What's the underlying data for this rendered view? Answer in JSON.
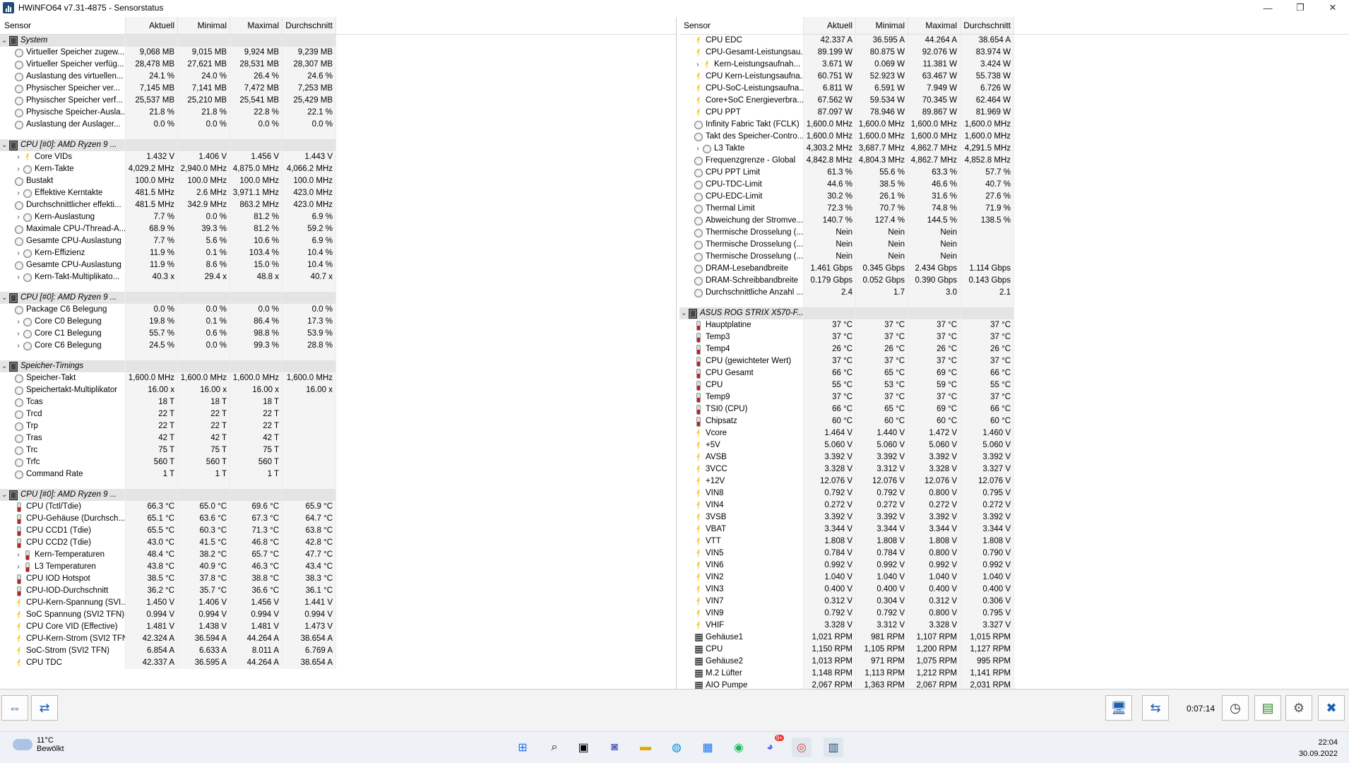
{
  "window": {
    "title": "HWiNFO64 v7.31-4875 - Sensorstatus",
    "buttons": [
      "—",
      "❐",
      "✕"
    ]
  },
  "columns": [
    "Sensor",
    "Aktuell",
    "Minimal",
    "Maximal",
    "Durchschnitt"
  ],
  "left_rows": [
    {
      "t": "g",
      "name": "System"
    },
    {
      "t": "r",
      "icon": "circle",
      "name": "Virtueller Speicher zugew...",
      "v": [
        "9,068 MB",
        "9,015 MB",
        "9,924 MB",
        "9,239 MB"
      ]
    },
    {
      "t": "r",
      "icon": "circle",
      "name": "Virtueller Speicher verfüg...",
      "v": [
        "28,478 MB",
        "27,621 MB",
        "28,531 MB",
        "28,307 MB"
      ]
    },
    {
      "t": "r",
      "icon": "circle",
      "name": "Auslastung des virtuellen...",
      "v": [
        "24.1 %",
        "24.0 %",
        "26.4 %",
        "24.6 %"
      ]
    },
    {
      "t": "r",
      "icon": "circle",
      "name": "Physischer Speicher ver...",
      "v": [
        "7,145 MB",
        "7,141 MB",
        "7,472 MB",
        "7,253 MB"
      ]
    },
    {
      "t": "r",
      "icon": "circle",
      "name": "Physischer Speicher verf...",
      "v": [
        "25,537 MB",
        "25,210 MB",
        "25,541 MB",
        "25,429 MB"
      ]
    },
    {
      "t": "r",
      "icon": "circle",
      "name": "Physische Speicher-Ausla...",
      "v": [
        "21.8 %",
        "21.8 %",
        "22.8 %",
        "22.1 %"
      ]
    },
    {
      "t": "r",
      "icon": "circle",
      "name": "Auslastung der Auslager...",
      "v": [
        "0.0 %",
        "0.0 %",
        "0.0 %",
        "0.0 %"
      ]
    },
    {
      "t": "s"
    },
    {
      "t": "g",
      "name": "CPU [#0]: AMD Ryzen 9 ..."
    },
    {
      "t": "r",
      "exp": true,
      "icon": "volt",
      "name": "Core VIDs",
      "v": [
        "1.432 V",
        "1.406 V",
        "1.456 V",
        "1.443 V"
      ]
    },
    {
      "t": "r",
      "exp": true,
      "icon": "circle",
      "name": "Kern-Takte",
      "v": [
        "4,029.2 MHz",
        "2,940.0 MHz",
        "4,875.0 MHz",
        "4,066.2 MHz"
      ]
    },
    {
      "t": "r",
      "icon": "circle",
      "name": "Bustakt",
      "v": [
        "100.0 MHz",
        "100.0 MHz",
        "100.0 MHz",
        "100.0 MHz"
      ]
    },
    {
      "t": "r",
      "exp": true,
      "icon": "circle",
      "name": "Effektive Kerntakte",
      "v": [
        "481.5 MHz",
        "2.6 MHz",
        "3,971.1 MHz",
        "423.0 MHz"
      ]
    },
    {
      "t": "r",
      "icon": "circle",
      "name": "Durchschnittlicher effekti...",
      "v": [
        "481.5 MHz",
        "342.9 MHz",
        "863.2 MHz",
        "423.0 MHz"
      ]
    },
    {
      "t": "r",
      "exp": true,
      "icon": "circle",
      "name": "Kern-Auslastung",
      "v": [
        "7.7 %",
        "0.0 %",
        "81.2 %",
        "6.9 %"
      ]
    },
    {
      "t": "r",
      "icon": "circle",
      "name": "Maximale CPU-/Thread-A...",
      "v": [
        "68.9 %",
        "39.3 %",
        "81.2 %",
        "59.2 %"
      ]
    },
    {
      "t": "r",
      "icon": "circle",
      "name": "Gesamte CPU-Auslastung",
      "v": [
        "7.7 %",
        "5.6 %",
        "10.6 %",
        "6.9 %"
      ]
    },
    {
      "t": "r",
      "exp": true,
      "icon": "circle",
      "name": "Kern-Effizienz",
      "v": [
        "11.9 %",
        "0.1 %",
        "103.4 %",
        "10.4 %"
      ]
    },
    {
      "t": "r",
      "icon": "circle",
      "name": "Gesamte CPU-Auslastung",
      "v": [
        "11.9 %",
        "8.6 %",
        "15.0 %",
        "10.4 %"
      ]
    },
    {
      "t": "r",
      "exp": true,
      "icon": "circle",
      "name": "Kern-Takt-Multiplikato...",
      "v": [
        "40.3 x",
        "29.4 x",
        "48.8 x",
        "40.7 x"
      ]
    },
    {
      "t": "s"
    },
    {
      "t": "g",
      "name": "CPU [#0]: AMD Ryzen 9 ..."
    },
    {
      "t": "r",
      "icon": "circle",
      "name": "Package C6 Belegung",
      "v": [
        "0.0 %",
        "0.0 %",
        "0.0 %",
        "0.0 %"
      ]
    },
    {
      "t": "r",
      "exp": true,
      "icon": "circle",
      "name": "Core C0 Belegung",
      "v": [
        "19.8 %",
        "0.1 %",
        "86.4 %",
        "17.3 %"
      ]
    },
    {
      "t": "r",
      "exp": true,
      "icon": "circle",
      "name": "Core C1 Belegung",
      "v": [
        "55.7 %",
        "0.6 %",
        "98.8 %",
        "53.9 %"
      ]
    },
    {
      "t": "r",
      "exp": true,
      "icon": "circle",
      "name": "Core C6 Belegung",
      "v": [
        "24.5 %",
        "0.0 %",
        "99.3 %",
        "28.8 %"
      ]
    },
    {
      "t": "s"
    },
    {
      "t": "g",
      "name": "Speicher-Timings"
    },
    {
      "t": "r",
      "icon": "circle",
      "name": "Speicher-Takt",
      "v": [
        "1,600.0 MHz",
        "1,600.0 MHz",
        "1,600.0 MHz",
        "1,600.0 MHz"
      ]
    },
    {
      "t": "r",
      "icon": "circle",
      "name": "Speichertakt-Multiplikator",
      "v": [
        "16.00 x",
        "16.00 x",
        "16.00 x",
        "16.00 x"
      ]
    },
    {
      "t": "r",
      "icon": "circle",
      "name": "Tcas",
      "v": [
        "18 T",
        "18 T",
        "18 T",
        ""
      ]
    },
    {
      "t": "r",
      "icon": "circle",
      "name": "Trcd",
      "v": [
        "22 T",
        "22 T",
        "22 T",
        ""
      ]
    },
    {
      "t": "r",
      "icon": "circle",
      "name": "Trp",
      "v": [
        "22 T",
        "22 T",
        "22 T",
        ""
      ]
    },
    {
      "t": "r",
      "icon": "circle",
      "name": "Tras",
      "v": [
        "42 T",
        "42 T",
        "42 T",
        ""
      ]
    },
    {
      "t": "r",
      "icon": "circle",
      "name": "Trc",
      "v": [
        "75 T",
        "75 T",
        "75 T",
        ""
      ]
    },
    {
      "t": "r",
      "icon": "circle",
      "name": "Trfc",
      "v": [
        "560 T",
        "560 T",
        "560 T",
        ""
      ]
    },
    {
      "t": "r",
      "icon": "circle",
      "name": "Command Rate",
      "v": [
        "1 T",
        "1 T",
        "1 T",
        ""
      ]
    },
    {
      "t": "s"
    },
    {
      "t": "g",
      "name": "CPU [#0]: AMD Ryzen 9 ..."
    },
    {
      "t": "r",
      "icon": "temp",
      "name": "CPU (Tctl/Tdie)",
      "v": [
        "66.3 °C",
        "65.0 °C",
        "69.6 °C",
        "65.9 °C"
      ]
    },
    {
      "t": "r",
      "icon": "temp",
      "name": "CPU-Gehäuse (Durchsch...",
      "v": [
        "65.1 °C",
        "63.6 °C",
        "67.3 °C",
        "64.7 °C"
      ]
    },
    {
      "t": "r",
      "icon": "temp",
      "name": "CPU CCD1 (Tdie)",
      "v": [
        "65.5 °C",
        "60.3 °C",
        "71.3 °C",
        "63.8 °C"
      ]
    },
    {
      "t": "r",
      "icon": "temp",
      "name": "CPU CCD2 (Tdie)",
      "v": [
        "43.0 °C",
        "41.5 °C",
        "46.8 °C",
        "42.8 °C"
      ]
    },
    {
      "t": "r",
      "exp": true,
      "icon": "temp",
      "name": "Kern-Temperaturen",
      "v": [
        "48.4 °C",
        "38.2 °C",
        "65.7 °C",
        "47.7 °C"
      ]
    },
    {
      "t": "r",
      "exp": true,
      "icon": "temp",
      "name": "L3 Temperaturen",
      "v": [
        "43.8 °C",
        "40.9 °C",
        "46.3 °C",
        "43.4 °C"
      ]
    },
    {
      "t": "r",
      "icon": "temp",
      "name": "CPU IOD Hotspot",
      "v": [
        "38.5 °C",
        "37.8 °C",
        "38.8 °C",
        "38.3 °C"
      ]
    },
    {
      "t": "r",
      "icon": "temp",
      "name": "CPU-IOD-Durchschnitt",
      "v": [
        "36.2 °C",
        "35.7 °C",
        "36.6 °C",
        "36.1 °C"
      ]
    },
    {
      "t": "r",
      "icon": "volt",
      "name": "CPU-Kern-Spannung (SVI...",
      "v": [
        "1.450 V",
        "1.406 V",
        "1.456 V",
        "1.441 V"
      ]
    },
    {
      "t": "r",
      "icon": "volt",
      "name": "SoC Spannung (SVI2 TFN)",
      "v": [
        "0.994 V",
        "0.994 V",
        "0.994 V",
        "0.994 V"
      ]
    },
    {
      "t": "r",
      "icon": "volt",
      "name": "CPU Core VID (Effective)",
      "v": [
        "1.481 V",
        "1.438 V",
        "1.481 V",
        "1.473 V"
      ]
    },
    {
      "t": "r",
      "icon": "volt",
      "name": "CPU-Kern-Strom (SVI2 TFN)",
      "v": [
        "42.324 A",
        "36.594 A",
        "44.264 A",
        "38.654 A"
      ]
    },
    {
      "t": "r",
      "icon": "volt",
      "name": "SoC-Strom (SVI2 TFN)",
      "v": [
        "6.854 A",
        "6.633 A",
        "8.011 A",
        "6.769 A"
      ]
    },
    {
      "t": "r",
      "icon": "volt",
      "name": "CPU TDC",
      "v": [
        "42.337 A",
        "36.595 A",
        "44.264 A",
        "38.654 A"
      ]
    }
  ],
  "right_rows": [
    {
      "t": "r",
      "icon": "volt",
      "name": "CPU EDC",
      "v": [
        "42.337 A",
        "36.595 A",
        "44.264 A",
        "38.654 A"
      ]
    },
    {
      "t": "r",
      "icon": "volt",
      "name": "CPU-Gesamt-Leistungsau...",
      "v": [
        "89.199 W",
        "80.875 W",
        "92.076 W",
        "83.974 W"
      ]
    },
    {
      "t": "r",
      "exp": true,
      "icon": "volt",
      "name": "Kern-Leistungsaufnah...",
      "v": [
        "3.671 W",
        "0.069 W",
        "11.381 W",
        "3.424 W"
      ]
    },
    {
      "t": "r",
      "icon": "volt",
      "name": "CPU Kern-Leistungsaufna...",
      "v": [
        "60.751 W",
        "52.923 W",
        "63.467 W",
        "55.738 W"
      ]
    },
    {
      "t": "r",
      "icon": "volt",
      "name": "CPU-SoC-Leistungsaufna...",
      "v": [
        "6.811 W",
        "6.591 W",
        "7.949 W",
        "6.726 W"
      ]
    },
    {
      "t": "r",
      "icon": "volt",
      "name": "Core+SoC Energieverbra...",
      "v": [
        "67.562 W",
        "59.534 W",
        "70.345 W",
        "62.464 W"
      ]
    },
    {
      "t": "r",
      "icon": "volt",
      "name": "CPU PPT",
      "v": [
        "87.097 W",
        "78.946 W",
        "89.867 W",
        "81.969 W"
      ]
    },
    {
      "t": "r",
      "icon": "circle",
      "name": "Infinity Fabric Takt (FCLK)",
      "v": [
        "1,600.0 MHz",
        "1,600.0 MHz",
        "1,600.0 MHz",
        "1,600.0 MHz"
      ]
    },
    {
      "t": "r",
      "icon": "circle",
      "name": "Takt des Speicher-Contro...",
      "v": [
        "1,600.0 MHz",
        "1,600.0 MHz",
        "1,600.0 MHz",
        "1,600.0 MHz"
      ]
    },
    {
      "t": "r",
      "exp": true,
      "icon": "circle",
      "name": "L3 Takte",
      "v": [
        "4,303.2 MHz",
        "3,687.7 MHz",
        "4,862.7 MHz",
        "4,291.5 MHz"
      ]
    },
    {
      "t": "r",
      "icon": "circle",
      "name": "Frequenzgrenze - Global",
      "v": [
        "4,842.8 MHz",
        "4,804.3 MHz",
        "4,862.7 MHz",
        "4,852.8 MHz"
      ]
    },
    {
      "t": "r",
      "icon": "circle",
      "name": "CPU PPT Limit",
      "v": [
        "61.3 %",
        "55.6 %",
        "63.3 %",
        "57.7 %"
      ]
    },
    {
      "t": "r",
      "icon": "circle",
      "name": "CPU-TDC-Limit",
      "v": [
        "44.6 %",
        "38.5 %",
        "46.6 %",
        "40.7 %"
      ]
    },
    {
      "t": "r",
      "icon": "circle",
      "name": "CPU-EDC-Limit",
      "v": [
        "30.2 %",
        "26.1 %",
        "31.6 %",
        "27.6 %"
      ]
    },
    {
      "t": "r",
      "icon": "circle",
      "name": "Thermal Limit",
      "v": [
        "72.3 %",
        "70.7 %",
        "74.8 %",
        "71.9 %"
      ]
    },
    {
      "t": "r",
      "icon": "circle",
      "name": "Abweichung der Stromve...",
      "v": [
        "140.7 %",
        "127.4 %",
        "144.5 %",
        "138.5 %"
      ]
    },
    {
      "t": "r",
      "icon": "circle",
      "name": "Thermische Drosselung (...",
      "v": [
        "Nein",
        "Nein",
        "Nein",
        ""
      ]
    },
    {
      "t": "r",
      "icon": "circle",
      "name": "Thermische Drosselung (...",
      "v": [
        "Nein",
        "Nein",
        "Nein",
        ""
      ]
    },
    {
      "t": "r",
      "icon": "circle",
      "name": "Thermische Drosselung (...",
      "v": [
        "Nein",
        "Nein",
        "Nein",
        ""
      ]
    },
    {
      "t": "r",
      "icon": "circle",
      "name": "DRAM-Lesebandbreite",
      "v": [
        "1.461 Gbps",
        "0.345 Gbps",
        "2.434 Gbps",
        "1.114 Gbps"
      ]
    },
    {
      "t": "r",
      "icon": "circle",
      "name": "DRAM-Schreibbandbreite",
      "v": [
        "0.179 Gbps",
        "0.052 Gbps",
        "0.390 Gbps",
        "0.143 Gbps"
      ]
    },
    {
      "t": "r",
      "icon": "circle",
      "name": "Durchschnittliche Anzahl ...",
      "v": [
        "2.4",
        "1.7",
        "3.0",
        "2.1"
      ]
    },
    {
      "t": "s"
    },
    {
      "t": "g",
      "name": "ASUS ROG STRIX X570-F..."
    },
    {
      "t": "r",
      "icon": "temp",
      "name": "Hauptplatine",
      "v": [
        "37 °C",
        "37 °C",
        "37 °C",
        "37 °C"
      ]
    },
    {
      "t": "r",
      "icon": "temp",
      "name": "Temp3",
      "v": [
        "37 °C",
        "37 °C",
        "37 °C",
        "37 °C"
      ]
    },
    {
      "t": "r",
      "icon": "temp",
      "name": "Temp4",
      "v": [
        "26 °C",
        "26 °C",
        "26 °C",
        "26 °C"
      ]
    },
    {
      "t": "r",
      "icon": "temp",
      "name": "CPU (gewichteter Wert)",
      "v": [
        "37 °C",
        "37 °C",
        "37 °C",
        "37 °C"
      ]
    },
    {
      "t": "r",
      "icon": "temp",
      "name": "CPU Gesamt",
      "v": [
        "66 °C",
        "65 °C",
        "69 °C",
        "66 °C"
      ]
    },
    {
      "t": "r",
      "icon": "temp",
      "name": "CPU",
      "v": [
        "55 °C",
        "53 °C",
        "59 °C",
        "55 °C"
      ]
    },
    {
      "t": "r",
      "icon": "temp",
      "name": "Temp9",
      "v": [
        "37 °C",
        "37 °C",
        "37 °C",
        "37 °C"
      ]
    },
    {
      "t": "r",
      "icon": "temp",
      "name": "TSI0 (CPU)",
      "v": [
        "66 °C",
        "65 °C",
        "69 °C",
        "66 °C"
      ]
    },
    {
      "t": "r",
      "icon": "temp",
      "name": "Chipsatz",
      "v": [
        "60 °C",
        "60 °C",
        "60 °C",
        "60 °C"
      ]
    },
    {
      "t": "r",
      "icon": "volt",
      "name": "Vcore",
      "v": [
        "1.464 V",
        "1.440 V",
        "1.472 V",
        "1.460 V"
      ]
    },
    {
      "t": "r",
      "icon": "volt",
      "name": "+5V",
      "v": [
        "5.060 V",
        "5.060 V",
        "5.060 V",
        "5.060 V"
      ]
    },
    {
      "t": "r",
      "icon": "volt",
      "name": "AVSB",
      "v": [
        "3.392 V",
        "3.392 V",
        "3.392 V",
        "3.392 V"
      ]
    },
    {
      "t": "r",
      "icon": "volt",
      "name": "3VCC",
      "v": [
        "3.328 V",
        "3.312 V",
        "3.328 V",
        "3.327 V"
      ]
    },
    {
      "t": "r",
      "icon": "volt",
      "name": "+12V",
      "v": [
        "12.076 V",
        "12.076 V",
        "12.076 V",
        "12.076 V"
      ]
    },
    {
      "t": "r",
      "icon": "volt",
      "name": "VIN8",
      "v": [
        "0.792 V",
        "0.792 V",
        "0.800 V",
        "0.795 V"
      ]
    },
    {
      "t": "r",
      "icon": "volt",
      "name": "VIN4",
      "v": [
        "0.272 V",
        "0.272 V",
        "0.272 V",
        "0.272 V"
      ]
    },
    {
      "t": "r",
      "icon": "volt",
      "name": "3VSB",
      "v": [
        "3.392 V",
        "3.392 V",
        "3.392 V",
        "3.392 V"
      ]
    },
    {
      "t": "r",
      "icon": "volt",
      "name": "VBAT",
      "v": [
        "3.344 V",
        "3.344 V",
        "3.344 V",
        "3.344 V"
      ]
    },
    {
      "t": "r",
      "icon": "volt",
      "name": "VTT",
      "v": [
        "1.808 V",
        "1.808 V",
        "1.808 V",
        "1.808 V"
      ]
    },
    {
      "t": "r",
      "icon": "volt",
      "name": "VIN5",
      "v": [
        "0.784 V",
        "0.784 V",
        "0.800 V",
        "0.790 V"
      ]
    },
    {
      "t": "r",
      "icon": "volt",
      "name": "VIN6",
      "v": [
        "0.992 V",
        "0.992 V",
        "0.992 V",
        "0.992 V"
      ]
    },
    {
      "t": "r",
      "icon": "volt",
      "name": "VIN2",
      "v": [
        "1.040 V",
        "1.040 V",
        "1.040 V",
        "1.040 V"
      ]
    },
    {
      "t": "r",
      "icon": "volt",
      "name": "VIN3",
      "v": [
        "0.400 V",
        "0.400 V",
        "0.400 V",
        "0.400 V"
      ]
    },
    {
      "t": "r",
      "icon": "volt",
      "name": "VIN7",
      "v": [
        "0.312 V",
        "0.304 V",
        "0.312 V",
        "0.306 V"
      ]
    },
    {
      "t": "r",
      "icon": "volt",
      "name": "VIN9",
      "v": [
        "0.792 V",
        "0.792 V",
        "0.800 V",
        "0.795 V"
      ]
    },
    {
      "t": "r",
      "icon": "volt",
      "name": "VHIF",
      "v": [
        "3.328 V",
        "3.312 V",
        "3.328 V",
        "3.327 V"
      ]
    },
    {
      "t": "r",
      "icon": "fan",
      "name": "Gehäuse1",
      "v": [
        "1,021 RPM",
        "981 RPM",
        "1,107 RPM",
        "1,015 RPM"
      ]
    },
    {
      "t": "r",
      "icon": "fan",
      "name": "CPU",
      "v": [
        "1,150 RPM",
        "1,105 RPM",
        "1,200 RPM",
        "1,127 RPM"
      ]
    },
    {
      "t": "r",
      "icon": "fan",
      "name": "Gehäuse2",
      "v": [
        "1,013 RPM",
        "971 RPM",
        "1,075 RPM",
        "995 RPM"
      ]
    },
    {
      "t": "r",
      "icon": "fan",
      "name": "M.2 Lüfter",
      "v": [
        "1,148 RPM",
        "1,113 RPM",
        "1,212 RPM",
        "1,141 RPM"
      ]
    },
    {
      "t": "r",
      "icon": "fan",
      "name": "AIO Pumpe",
      "v": [
        "2,067 RPM",
        "1,363 RPM",
        "2,067 RPM",
        "2,031 RPM"
      ]
    }
  ],
  "bottombar": {
    "timer": "0:07:14"
  },
  "taskbar": {
    "weather_temp": "11°C",
    "weather_desc": "Bewölkt",
    "time": "22:04",
    "date": "30.09.2022",
    "discord_badge": "9+"
  }
}
